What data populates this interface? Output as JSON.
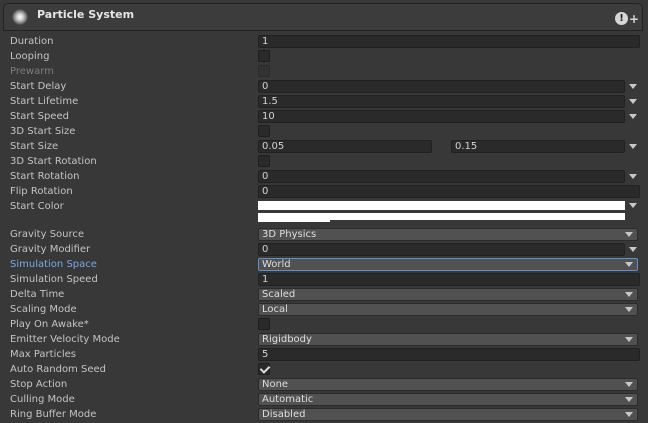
{
  "header": {
    "title": "Particle System"
  },
  "rows": {
    "duration": {
      "label": "Duration",
      "value": "1"
    },
    "looping": {
      "label": "Looping"
    },
    "prewarm": {
      "label": "Prewarm"
    },
    "start_delay": {
      "label": "Start Delay",
      "value": "0"
    },
    "start_lifetime": {
      "label": "Start Lifetime",
      "value": "1.5"
    },
    "start_speed": {
      "label": "Start Speed",
      "value": "10"
    },
    "start_size_3d": {
      "label": "3D Start Size"
    },
    "start_size": {
      "label": "Start Size",
      "min": "0.05",
      "max": "0.15"
    },
    "start_rotation_3d": {
      "label": "3D Start Rotation"
    },
    "start_rotation": {
      "label": "Start Rotation",
      "value": "0"
    },
    "flip_rotation": {
      "label": "Flip Rotation",
      "value": "0"
    },
    "start_color": {
      "label": "Start Color",
      "color": "#ffffff"
    },
    "gravity_source": {
      "label": "Gravity Source",
      "value": "3D Physics"
    },
    "gravity_modifier": {
      "label": "Gravity Modifier",
      "value": "0"
    },
    "simulation_space": {
      "label": "Simulation Space",
      "value": "World"
    },
    "simulation_speed": {
      "label": "Simulation Speed",
      "value": "1"
    },
    "delta_time": {
      "label": "Delta Time",
      "value": "Scaled"
    },
    "scaling_mode": {
      "label": "Scaling Mode",
      "value": "Local"
    },
    "play_on_awake": {
      "label": "Play On Awake*"
    },
    "emitter_velocity_mode": {
      "label": "Emitter Velocity Mode",
      "value": "Rigidbody"
    },
    "max_particles": {
      "label": "Max Particles",
      "value": "5"
    },
    "auto_random_seed": {
      "label": "Auto Random Seed",
      "checked": true
    },
    "stop_action": {
      "label": "Stop Action",
      "value": "None"
    },
    "culling_mode": {
      "label": "Culling Mode",
      "value": "Automatic"
    },
    "ring_buffer_mode": {
      "label": "Ring Buffer Mode",
      "value": "Disabled"
    }
  },
  "colors": {
    "accent": "#7aa7e9",
    "panel": "#383838",
    "field": "#2a2a2a",
    "dropdown": "#515151"
  }
}
